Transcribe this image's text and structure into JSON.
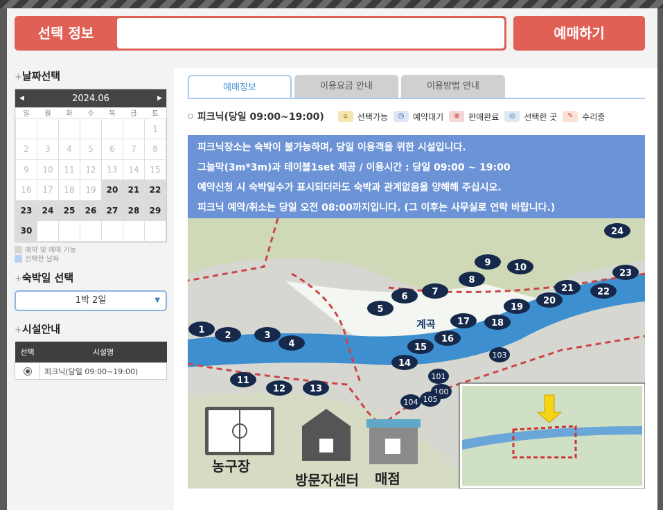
{
  "header": {
    "selection_label": "선택 정보",
    "book_button": "예매하기"
  },
  "date_section": {
    "title": "날짜선택",
    "calendar": {
      "month": "2024.06",
      "prev": "◀",
      "next": "▶",
      "weekdays": [
        "일",
        "월",
        "화",
        "수",
        "목",
        "금",
        "토"
      ]
    }
  },
  "legend": {
    "available": "예약 및 예매 가능",
    "selected": "선택한 날짜"
  },
  "stay_section": {
    "title": "숙박일 선택",
    "value": "1박 2일"
  },
  "facility_section": {
    "title": "시설안내",
    "col_select": "선택",
    "col_name": "시설명",
    "row": "피크닉(당일 09:00~19:00)"
  },
  "tabs": [
    "예매정보",
    "이용요금 안내",
    "이용방법 안내"
  ],
  "status": {
    "title": "피크닉(당일 09:00~19:00)",
    "items": [
      "선택가능",
      "예약대기",
      "판매완료",
      "선택한 곳",
      "수리중"
    ]
  },
  "notice": [
    "피크닉장소는 숙박이 불가능하며, 당일 이용객을 위한 시설입니다.",
    "그늘막(3m*3m)과 테이블1set 제공 / 이용시간 : 당일 09:00 ~ 19:00",
    "예약신청 시 숙박일수가 표시되더라도 숙박과 관계없음을 양해해 주십시오.",
    "피크닉 예약/취소는 당일 오전 08:00까지입니다. (그 이후는 사무실로 연락 바랍니다.)"
  ],
  "map": {
    "stream": "계곡",
    "court": "농구장",
    "visitor": "방문자센터",
    "shop": "매점",
    "spots": [
      "1",
      "2",
      "3",
      "4",
      "5",
      "6",
      "7",
      "8",
      "9",
      "10",
      "11",
      "12",
      "13",
      "14",
      "15",
      "16",
      "17",
      "18",
      "19",
      "20",
      "21",
      "22",
      "23",
      "24"
    ],
    "other": [
      "100",
      "101",
      "103",
      "104",
      "105"
    ]
  },
  "colors": {
    "accent": "#e06056",
    "notice": "#6b93d6",
    "tab_active": "#4a90d9"
  }
}
